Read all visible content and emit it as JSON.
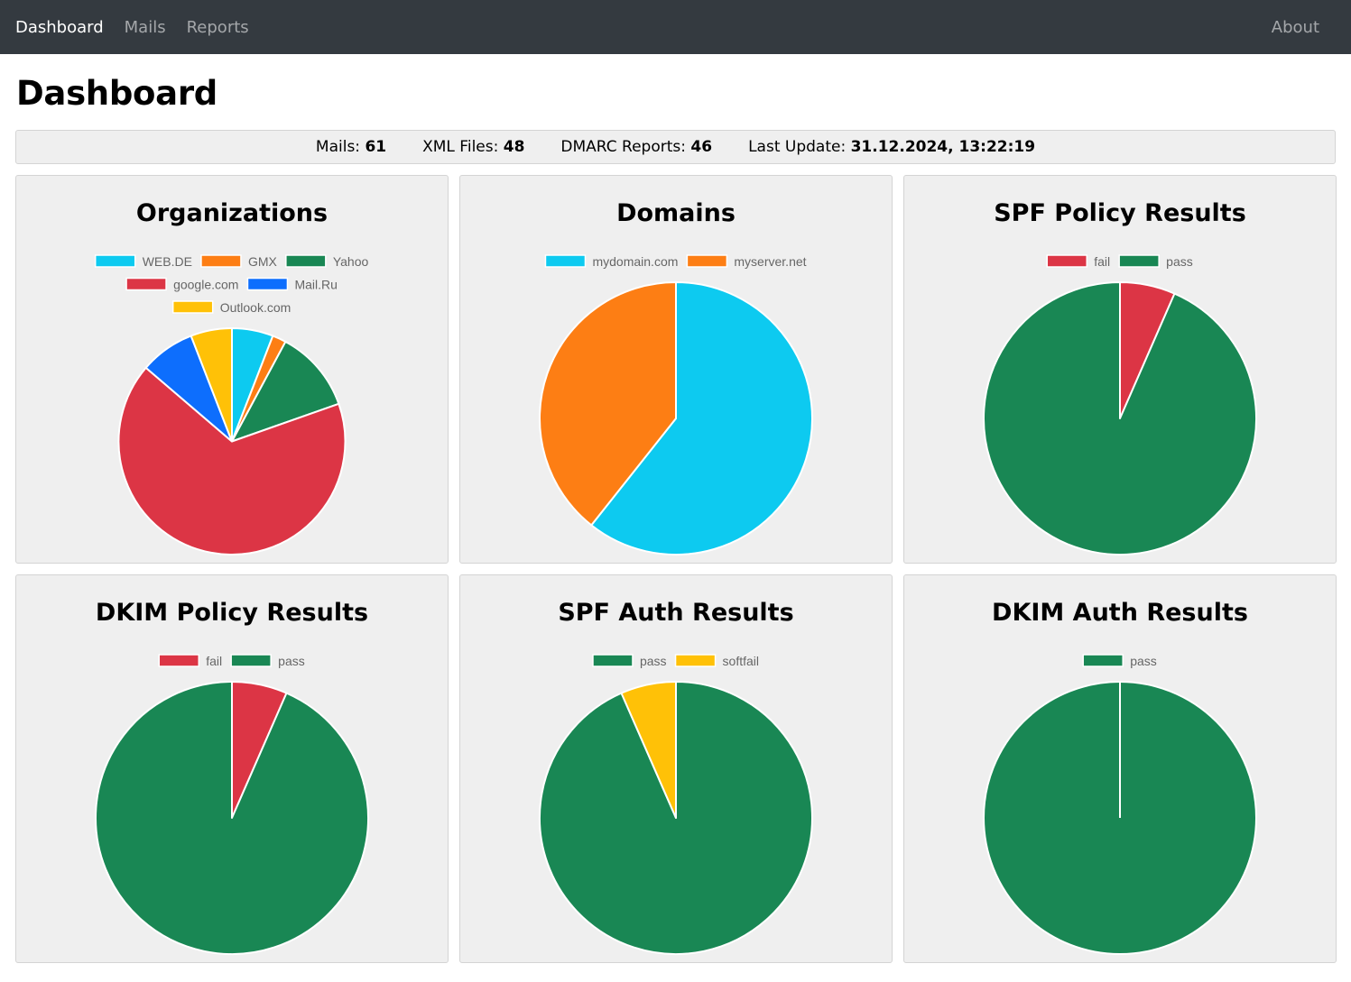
{
  "nav": {
    "items": [
      {
        "label": "Dashboard",
        "active": true
      },
      {
        "label": "Mails",
        "active": false
      },
      {
        "label": "Reports",
        "active": false
      }
    ],
    "about": "About"
  },
  "page_title": "Dashboard",
  "stats": {
    "mails_label": "Mails:",
    "mails": "61",
    "xml_label": "XML Files:",
    "xml": "48",
    "dmarc_label": "DMARC Reports:",
    "dmarc": "46",
    "update_label": "Last Update:",
    "update": "31.12.2024, 13:22:19"
  },
  "colors": {
    "cyan": "#0dcaf0",
    "orange": "#fd7e14",
    "green": "#198754",
    "red": "#dc3545",
    "blue": "#0d6efd",
    "yellow": "#ffc107"
  },
  "chart_data": [
    {
      "type": "pie",
      "title": "Organizations",
      "categories": [
        "WEB.DE",
        "GMX",
        "Yahoo",
        "google.com",
        "Mail.Ru",
        "Outlook.com"
      ],
      "values": [
        3,
        1,
        6,
        34,
        4,
        3
      ],
      "colors": [
        "#0dcaf0",
        "#fd7e14",
        "#198754",
        "#dc3545",
        "#0d6efd",
        "#ffc107"
      ],
      "legend_rows": [
        [
          0,
          1,
          2
        ],
        [
          3,
          4
        ],
        [
          5
        ]
      ]
    },
    {
      "type": "pie",
      "title": "Domains",
      "categories": [
        "mydomain.com",
        "myserver.net"
      ],
      "values": [
        37,
        24
      ],
      "colors": [
        "#0dcaf0",
        "#fd7e14"
      ],
      "legend_rows": [
        [
          0,
          1
        ]
      ]
    },
    {
      "type": "pie",
      "title": "SPF Policy Results",
      "categories": [
        "fail",
        "pass"
      ],
      "values": [
        4,
        57
      ],
      "colors": [
        "#dc3545",
        "#198754"
      ],
      "legend_rows": [
        [
          0,
          1
        ]
      ]
    },
    {
      "type": "pie",
      "title": "DKIM Policy Results",
      "categories": [
        "fail",
        "pass"
      ],
      "values": [
        4,
        57
      ],
      "colors": [
        "#dc3545",
        "#198754"
      ],
      "legend_rows": [
        [
          0,
          1
        ]
      ]
    },
    {
      "type": "pie",
      "title": "SPF Auth Results",
      "categories": [
        "pass",
        "softfail"
      ],
      "values": [
        57,
        4
      ],
      "colors": [
        "#198754",
        "#ffc107"
      ],
      "legend_rows": [
        [
          0,
          1
        ]
      ]
    },
    {
      "type": "pie",
      "title": "DKIM Auth Results",
      "categories": [
        "pass"
      ],
      "values": [
        61
      ],
      "colors": [
        "#198754"
      ],
      "legend_rows": [
        [
          0
        ]
      ]
    }
  ]
}
